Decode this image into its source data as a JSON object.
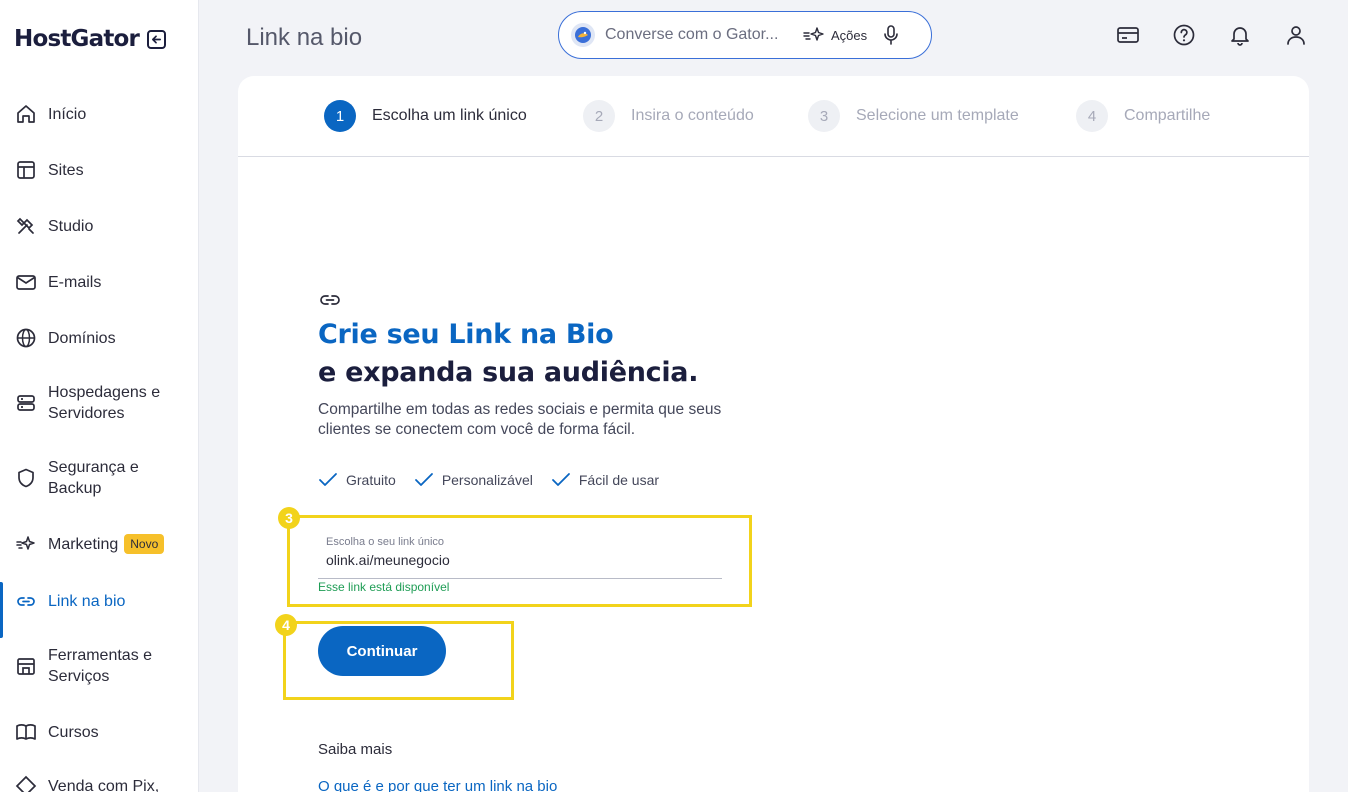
{
  "sidebar": {
    "logo": "HostGator",
    "items": [
      {
        "label": "Início"
      },
      {
        "label": "Sites"
      },
      {
        "label": "Studio"
      },
      {
        "label": "E-mails"
      },
      {
        "label": "Domínios"
      },
      {
        "label": "Hospedagens e Servidores"
      },
      {
        "label": "Segurança e Backup"
      },
      {
        "label": "Marketing",
        "badge": "Novo"
      },
      {
        "label": "Link na bio",
        "active": true
      },
      {
        "label": "Ferramentas e Serviços"
      },
      {
        "label": "Cursos"
      },
      {
        "label": "Venda com Pix,"
      }
    ]
  },
  "header": {
    "title": "Link na bio",
    "search_placeholder": "Converse com o Gator...",
    "actions_label": "Ações"
  },
  "steps": [
    {
      "number": "1",
      "label": "Escolha um link único"
    },
    {
      "number": "2",
      "label": "Insira o conteúdo"
    },
    {
      "number": "3",
      "label": "Selecione um template"
    },
    {
      "number": "4",
      "label": "Compartilhe"
    }
  ],
  "hero": {
    "title": "Crie seu Link na Bio",
    "subtitle": "e expanda sua audiência.",
    "description": "Compartilhe em todas as redes sociais e permita que seus clientes se conectem com você de forma fácil."
  },
  "features": [
    "Gratuito",
    "Personalizável",
    "Fácil de usar"
  ],
  "link_field": {
    "label": "Escolha o seu link único",
    "value": "olink.ai/meunegocio",
    "help": "Esse link está disponível"
  },
  "annotations": [
    "3",
    "4"
  ],
  "continue_label": "Continuar",
  "learn_more": {
    "title": "Saiba mais",
    "link": "O que é e por que ter um link na bio"
  },
  "colors": {
    "accent": "#0a66c2",
    "highlight": "#f2d31b",
    "success": "#1f9d55",
    "badge": "#f6c02a"
  }
}
